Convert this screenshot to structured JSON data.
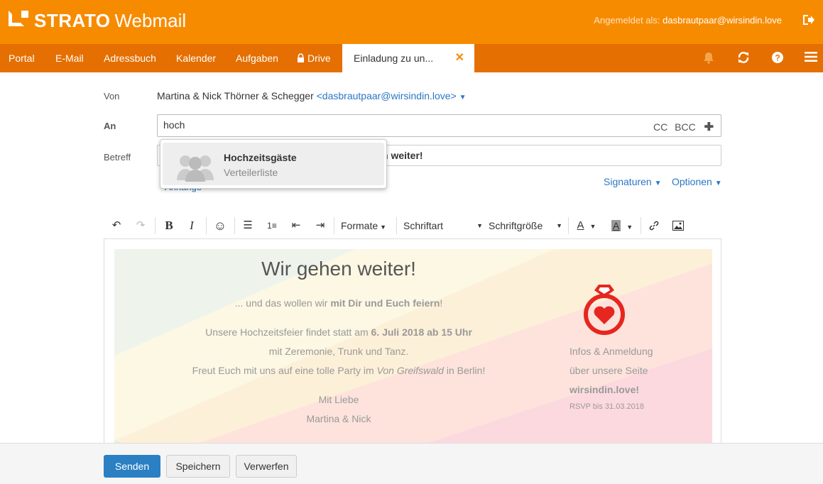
{
  "brand": {
    "name": "STRATO",
    "product": "Webmail"
  },
  "login": {
    "label": "Angemeldet als:",
    "user": "dasbrautpaar@wirsindin.love"
  },
  "nav": {
    "items": [
      "Portal",
      "E-Mail",
      "Adressbuch",
      "Kalender",
      "Aufgaben",
      "Drive"
    ],
    "active_tab": "Einladung zu un..."
  },
  "form": {
    "from_label": "Von",
    "from_name": "Martina & Nick Thörner & Schegger",
    "from_email": "<dasbrautpaar@wirsindin.love>",
    "to_label": "An",
    "to_value": "hoch",
    "cc": "CC",
    "bcc": "BCC",
    "subject_label": "Betreff",
    "subject_visible": "n weiter!",
    "attach_label": "Anhänge",
    "signatures": "Signaturen",
    "options": "Optionen"
  },
  "autocomplete": {
    "title": "Hochzeitsgäste",
    "subtitle": "Verteilerliste"
  },
  "toolbar": {
    "formats": "Formate",
    "font": "Schriftart",
    "font_size": "Schriftgröße"
  },
  "card": {
    "heading": "Wir gehen weiter!",
    "line1_a": "... und das wollen wir ",
    "line1_b": "mit Dir und Euch feiern",
    "line1_c": "!",
    "line2_a": "Unsere Hochzeitsfeier findet statt am ",
    "line2_b": "6. Juli 2018 ab 15 Uhr",
    "line3": "mit Zeremonie, Trunk und Tanz.",
    "line4_a": "Freut Euch mit uns auf eine tolle Party im ",
    "line4_b": "Von Greifswald",
    "line4_c": " in Berlin!",
    "closing": "Mit Liebe",
    "names": "Martina & Nick",
    "info1": "Infos & Anmeldung",
    "info2": "über unsere Seite",
    "site": "wirsindin.love!",
    "rsvp": "RSVP bis 31.03.2018"
  },
  "buttons": {
    "send": "Senden",
    "save": "Speichern",
    "discard": "Verwerfen"
  },
  "colors": {
    "brand_orange": "#f78b00",
    "nav_orange": "#e56f00",
    "link_blue": "#2b76c4",
    "primary_blue": "#2b7fc3",
    "ring_red": "#e6261f"
  }
}
